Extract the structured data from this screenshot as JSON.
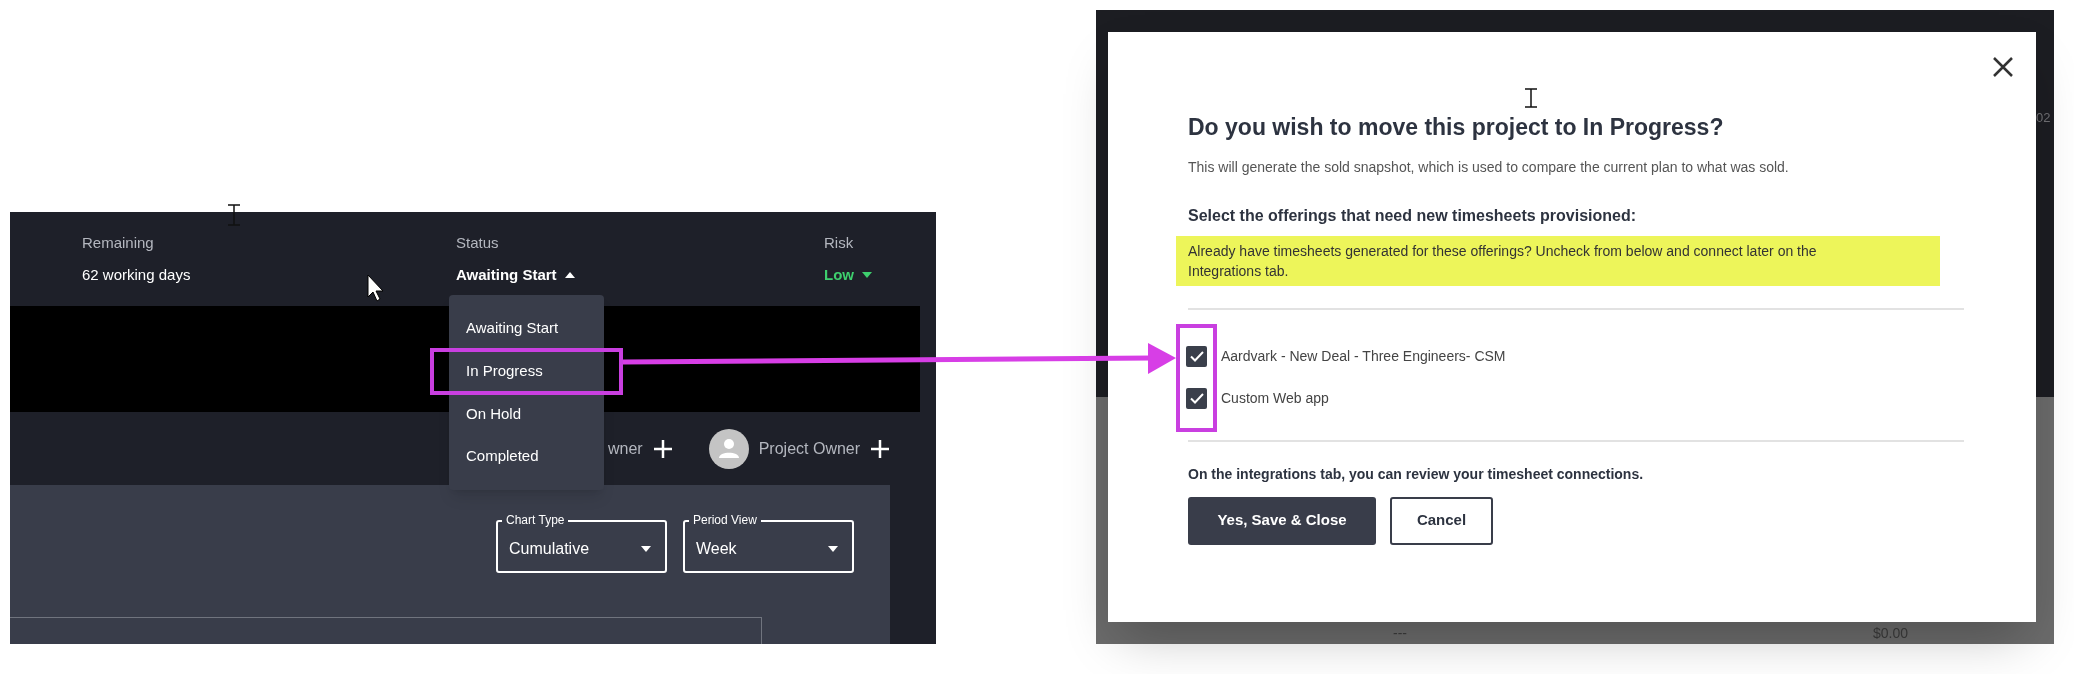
{
  "left_screen": {
    "summary": [
      {
        "kind": "text",
        "label": "Remaining",
        "value": "62 working days"
      },
      {
        "kind": "status",
        "label": "Status",
        "value": "Awaiting Start",
        "expanded": true
      },
      {
        "kind": "risk",
        "label": "Risk",
        "value": "Low",
        "expanded": false
      }
    ],
    "status_menu": [
      {
        "label": "Awaiting Start",
        "highlighted": false
      },
      {
        "label": "In Progress",
        "highlighted": true
      },
      {
        "label": "On Hold",
        "highlighted": false
      },
      {
        "label": "Completed",
        "highlighted": false
      }
    ],
    "owners": [
      {
        "label": "wner",
        "avatar": false
      },
      {
        "label": "Project Owner",
        "avatar": true
      }
    ],
    "filters": [
      {
        "label": "Chart Type",
        "value": "Cumulative"
      },
      {
        "label": "Period View",
        "value": "Week"
      }
    ]
  },
  "right_screen": {
    "background_texts": [
      "02",
      "---",
      "$0.00"
    ],
    "modal": {
      "title": "Do you wish to move this project to In Progress?",
      "description": "This will generate the sold snapshot, which is used to compare the current plan to what was sold.",
      "section_heading": "Select the offerings that need new timesheets provisioned:",
      "notice": "Already have timesheets generated for these offerings? Uncheck from below and connect later on the Integrations tab.",
      "offerings_highlighted": true,
      "offerings": [
        {
          "label": "Aardvark - New Deal - Three Engineers- CSM",
          "checked": true
        },
        {
          "label": "Custom Web app",
          "checked": true
        }
      ],
      "footer_note": "On the integrations tab, you can review your timesheet connections.",
      "buttons": [
        {
          "label": "Yes, Save & Close",
          "kind": "primary"
        },
        {
          "label": "Cancel",
          "kind": "secondary"
        }
      ]
    }
  }
}
